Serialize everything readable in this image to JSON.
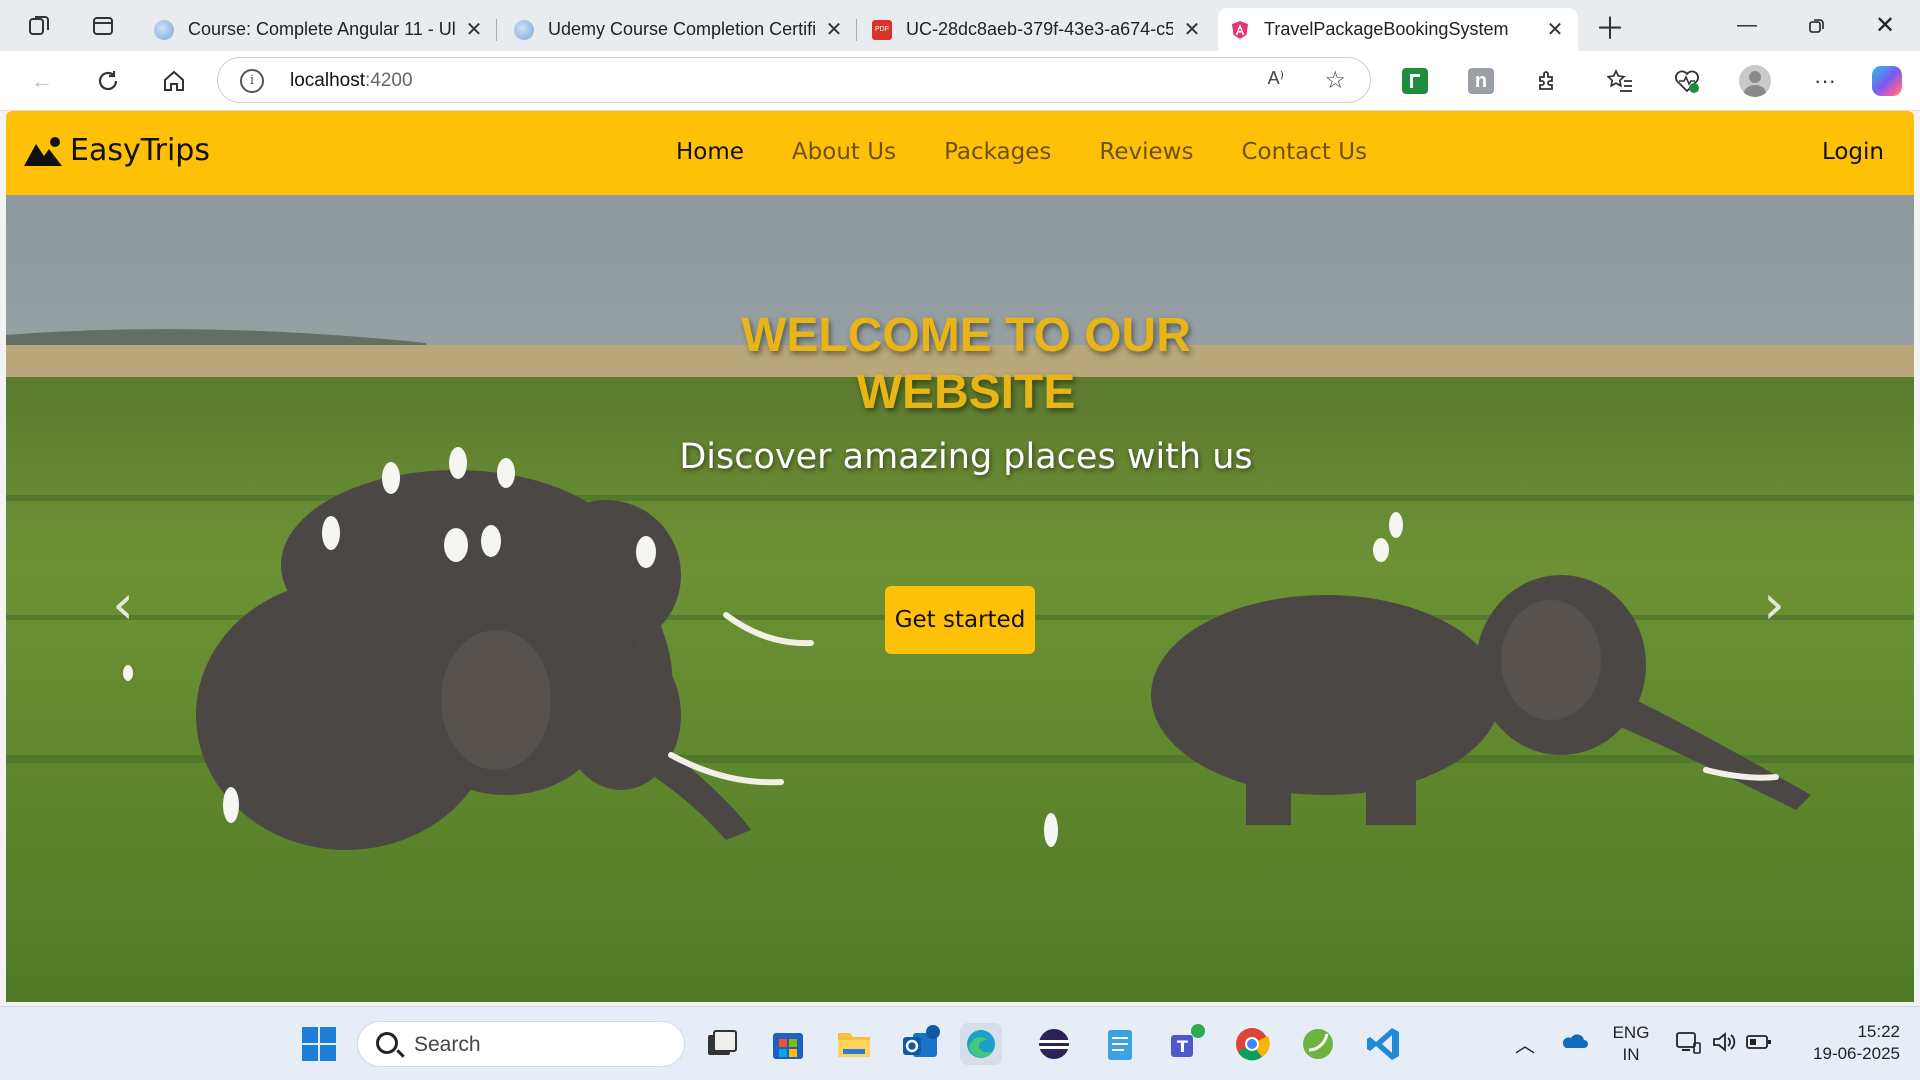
{
  "browser": {
    "tabs": [
      {
        "title": "Course: Complete Angular 11 - Ul"
      },
      {
        "title": "Udemy Course Completion Certifi"
      },
      {
        "title": "UC-28dc8aeb-379f-43e3-a674-c5"
      },
      {
        "title": "TravelPackageBookingSystem"
      }
    ],
    "url_host": "localhost",
    "url_port": ":4200",
    "read_aloud": "A⁾"
  },
  "site": {
    "brand": "EasyTrips",
    "nav": [
      "Home",
      "About Us",
      "Packages",
      "Reviews",
      "Contact Us"
    ],
    "login": "Login",
    "hero": {
      "title": "WELCOME TO OUR WEBSITE",
      "subtitle": "Discover amazing places with us",
      "cta": "Get started"
    }
  },
  "taskbar": {
    "search_placeholder": "Search",
    "lang_top": "ENG",
    "lang_bottom": "IN",
    "time": "15:22",
    "date": "19-06-2025"
  }
}
